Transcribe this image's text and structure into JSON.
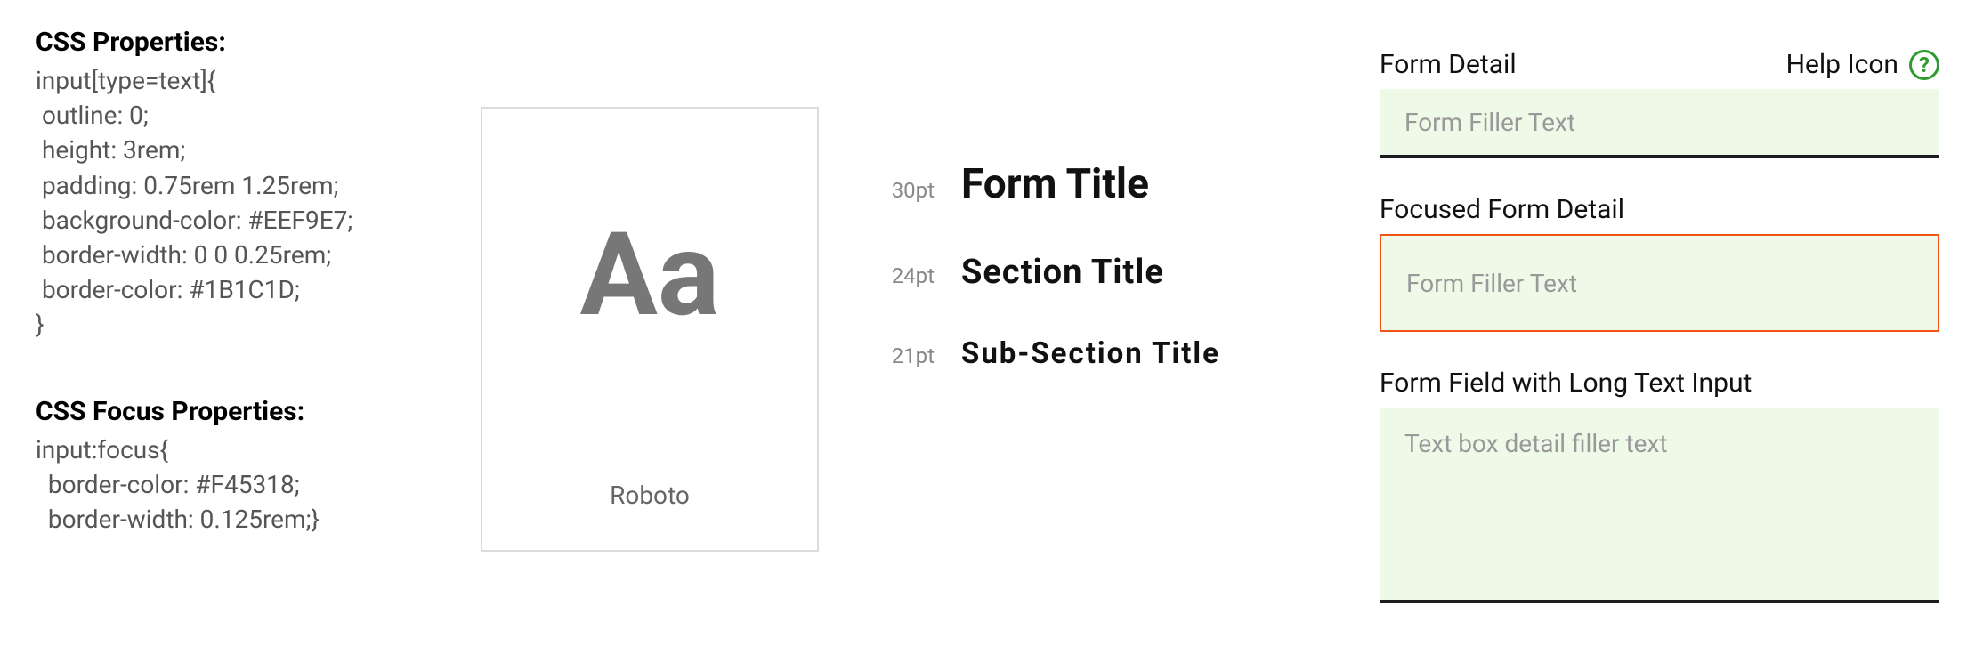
{
  "css_props": {
    "heading": "CSS Properties:",
    "code": "input[type=text]{\n outline: 0;\n height: 3rem;\n padding: 0.75rem 1.25rem;\n background-color: #EEF9E7;\n border-width: 0 0 0.25rem;\n border-color: #1B1C1D;\n}"
  },
  "css_focus": {
    "heading": "CSS Focus Properties:",
    "code": "input:focus{\n  border-color: #F45318;\n  border-width: 0.125rem;}"
  },
  "font_card": {
    "sample": "Aa",
    "name": "Roboto"
  },
  "type_scale": {
    "rows": [
      {
        "size": "30pt",
        "label": "Form Title"
      },
      {
        "size": "24pt",
        "label": "Section Title"
      },
      {
        "size": "21pt",
        "label": "Sub-Section Title"
      }
    ]
  },
  "forms": {
    "row1": {
      "label": "Form Detail",
      "help_text": "Help Icon",
      "help_glyph": "?",
      "placeholder": "Form Filler Text"
    },
    "row2": {
      "label": "Focused Form Detail",
      "placeholder": "Form Filler Text"
    },
    "row3": {
      "label": "Form Field with Long Text Input",
      "placeholder": "Text box detail filler text"
    }
  }
}
